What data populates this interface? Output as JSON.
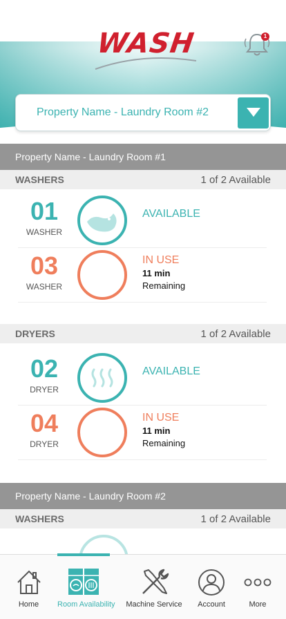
{
  "header": {
    "logo_text": "WASH",
    "notification_count": "1",
    "property_selector": "Property Name - Laundry Room #2"
  },
  "rooms": [
    {
      "name": "Property Name - Laundry Room #1",
      "groups": [
        {
          "type": "WASHERS",
          "availability": "1 of 2 Available",
          "machines": [
            {
              "number": "01",
              "kind": "WASHER",
              "status": "AVAILABLE",
              "icon": "washer-water-icon"
            },
            {
              "number": "03",
              "kind": "WASHER",
              "status": "IN USE",
              "time": "11 min",
              "remaining": "Remaining",
              "icon": "in-use-ring-icon"
            }
          ]
        },
        {
          "type": "DRYERS",
          "availability": "1 of 2 Available",
          "machines": [
            {
              "number": "02",
              "kind": "DRYER",
              "status": "AVAILABLE",
              "icon": "dryer-heat-icon"
            },
            {
              "number": "04",
              "kind": "DRYER",
              "status": "IN USE",
              "time": "11 min",
              "remaining": "Remaining",
              "icon": "in-use-ring-icon"
            }
          ]
        }
      ]
    },
    {
      "name": "Property Name - Laundry Room #2",
      "groups": [
        {
          "type": "WASHERS",
          "availability": "1 of 2 Available"
        }
      ]
    }
  ],
  "tabs": [
    {
      "label": "Home",
      "icon": "home-icon"
    },
    {
      "label": "Room Availability",
      "icon": "room-availability-icon"
    },
    {
      "label": "Machine Service",
      "icon": "wrench-screwdriver-icon"
    },
    {
      "label": "Account",
      "icon": "user-icon"
    },
    {
      "label": "More",
      "icon": "more-dots-icon"
    }
  ],
  "colors": {
    "accent": "#3bb3b1",
    "in_use": "#ef7e5c",
    "brand_red": "#d0202e",
    "room_bar": "#959595"
  }
}
